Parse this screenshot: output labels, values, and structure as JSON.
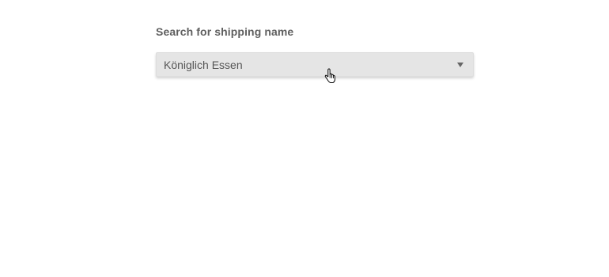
{
  "form": {
    "label": "Search for shipping name",
    "select": {
      "value": "Königlich Essen",
      "icon": "chevron-down-icon"
    }
  },
  "cursor": {
    "icon": "hand-pointer-icon"
  }
}
